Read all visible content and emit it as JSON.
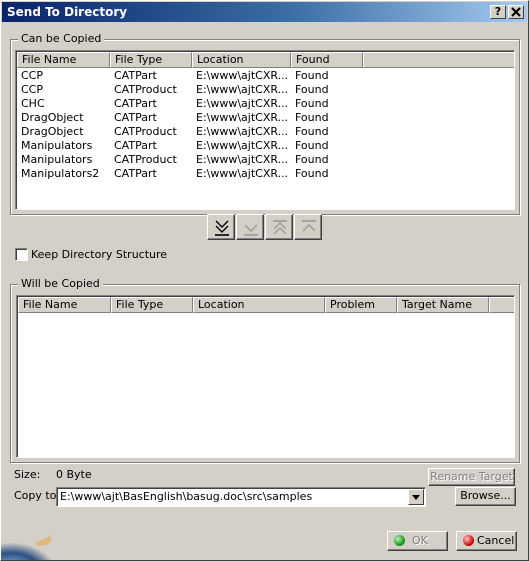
{
  "window": {
    "title": "Send To Directory",
    "help_label": "?",
    "close_label": "X"
  },
  "can_be_copied": {
    "label": "Can be Copied",
    "columns": [
      "File Name",
      "File Type",
      "Location",
      "Found"
    ],
    "rows": [
      {
        "name": "CCP",
        "type": "CATPart",
        "location": "E:\\www\\ajtCXR...",
        "found": "Found"
      },
      {
        "name": "CCP",
        "type": "CATProduct",
        "location": "E:\\www\\ajtCXR...",
        "found": "Found"
      },
      {
        "name": "CHC",
        "type": "CATPart",
        "location": "E:\\www\\ajtCXR...",
        "found": "Found"
      },
      {
        "name": "DragObject",
        "type": "CATPart",
        "location": "E:\\www\\ajtCXR...",
        "found": "Found"
      },
      {
        "name": "DragObject",
        "type": "CATProduct",
        "location": "E:\\www\\ajtCXR...",
        "found": "Found"
      },
      {
        "name": "Manipulators",
        "type": "CATPart",
        "location": "E:\\www\\ajtCXR...",
        "found": "Found"
      },
      {
        "name": "Manipulators",
        "type": "CATProduct",
        "location": "E:\\www\\ajtCXR...",
        "found": "Found"
      },
      {
        "name": "Manipulators2",
        "type": "CATPart",
        "location": "E:\\www\\ajtCXR...",
        "found": "Found"
      }
    ]
  },
  "transfer_buttons": [
    {
      "name": "copy-all-down-icon",
      "enabled": true
    },
    {
      "name": "copy-selected-down-icon",
      "enabled": false
    },
    {
      "name": "remove-all-up-icon",
      "enabled": false
    },
    {
      "name": "remove-selected-up-icon",
      "enabled": false
    }
  ],
  "keep_structure": {
    "label": "Keep Directory Structure",
    "checked": false
  },
  "will_be_copied": {
    "label": "Will be Copied",
    "columns": [
      "File Name",
      "File Type",
      "Location",
      "Problem",
      "Target Name"
    ],
    "rows": []
  },
  "size": {
    "label": "Size:",
    "value": "0 Byte"
  },
  "copy_to": {
    "label": "Copy to:",
    "value": "E:\\www\\ajt\\BasEnglish\\basug.doc\\src\\samples"
  },
  "buttons": {
    "rename_target": "Rename Target",
    "browse": "Browse...",
    "ok": "OK",
    "cancel": "Cancel"
  },
  "colors": {
    "titlebar_start": "#0a246a",
    "titlebar_end": "#a6caf0",
    "ok_icon": "#1aa01a",
    "cancel_icon": "#d01010"
  }
}
